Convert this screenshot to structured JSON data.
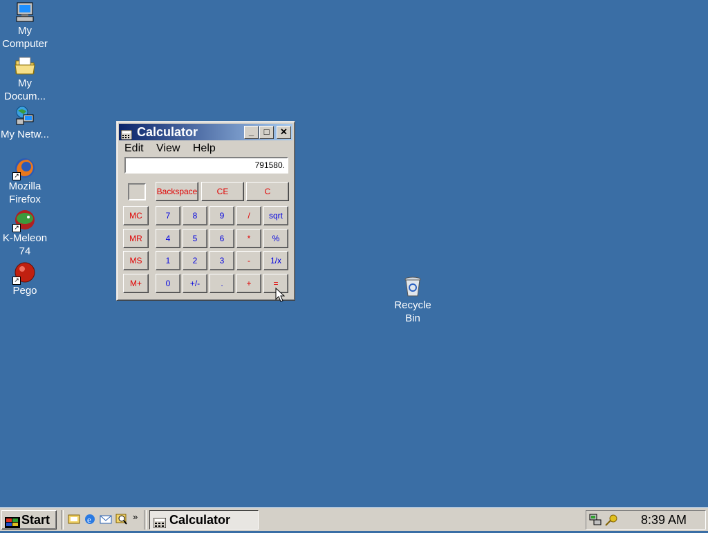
{
  "desktop": {
    "icons": [
      {
        "label": "My Computer"
      },
      {
        "label": "My Docum..."
      },
      {
        "label": "My Netw..."
      },
      {
        "label": "Mozilla Firefox"
      },
      {
        "label": "K-Meleon 74"
      },
      {
        "label": "Pego"
      },
      {
        "label": "Recycle Bin"
      }
    ],
    "background_color": "#3a6ea5"
  },
  "calculator": {
    "title": "Calculator",
    "title_buttons": {
      "minimize": "_",
      "maximize": "□",
      "close": "✕"
    },
    "menu": [
      "Edit",
      "View",
      "Help"
    ],
    "display": "791580.",
    "top_keys": [
      "Backspace",
      "CE",
      "C"
    ],
    "memory_keys": [
      "MC",
      "MR",
      "MS",
      "M+"
    ],
    "rows": [
      [
        "7",
        "8",
        "9",
        "/",
        "sqrt"
      ],
      [
        "4",
        "5",
        "6",
        "*",
        "%"
      ],
      [
        "1",
        "2",
        "3",
        "-",
        "1/x"
      ],
      [
        "0",
        "+/-",
        ".",
        "+",
        "="
      ]
    ]
  },
  "taskbar": {
    "start_label": "Start",
    "quick_launch_icons": [
      "desktop-icon",
      "ie-icon",
      "outlook-icon",
      "search-icon"
    ],
    "more": "»",
    "task_label": "Calculator",
    "clock": "8:39 AM"
  },
  "colors": {
    "title_start": "#0a246a",
    "title_end": "#a6caf0",
    "face": "#d4d0c8",
    "key_red": "#e00000",
    "key_blue": "#0000e0"
  }
}
